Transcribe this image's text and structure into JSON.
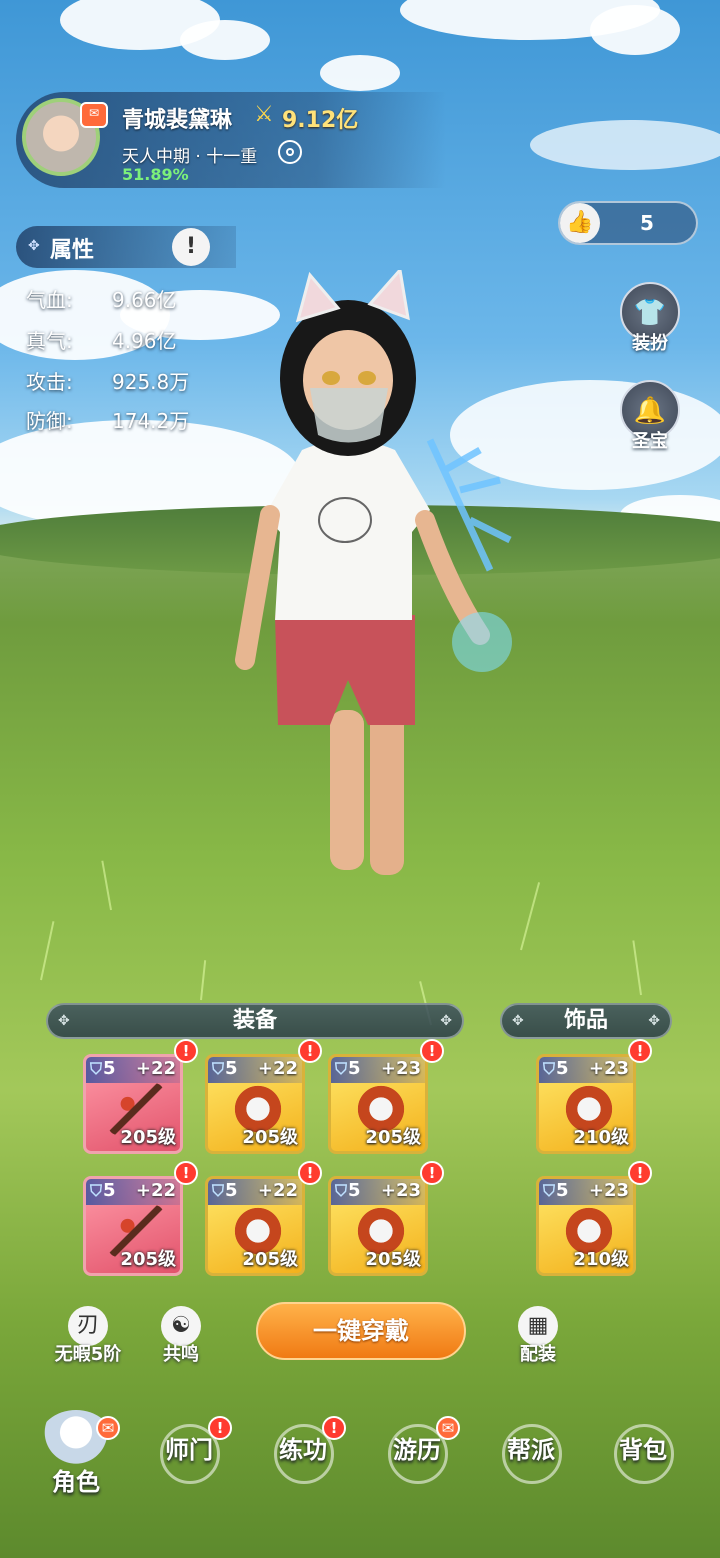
{
  "player": {
    "name": "青城裴黛琳",
    "power": "9.12亿",
    "realm": "天人中期 · 十一重",
    "progress": "51.89%"
  },
  "likes": {
    "count": "5"
  },
  "attributes": {
    "title": "属性",
    "stats": [
      {
        "label": "气血:",
        "value": "9.66亿"
      },
      {
        "label": "真气:",
        "value": "4.96亿"
      },
      {
        "label": "攻击:",
        "value": "925.8万"
      },
      {
        "label": "防御:",
        "value": "174.2万"
      }
    ]
  },
  "side_buttons": {
    "outfit": "装扮",
    "treasure": "圣宝"
  },
  "equipment": {
    "title": "装备",
    "items": [
      {
        "rank": "5",
        "plus": "+22",
        "level": "205级"
      },
      {
        "rank": "5",
        "plus": "+22",
        "level": "205级"
      },
      {
        "rank": "5",
        "plus": "+23",
        "level": "205级"
      },
      {
        "rank": "5",
        "plus": "+22",
        "level": "205级"
      },
      {
        "rank": "5",
        "plus": "+22",
        "level": "205级"
      },
      {
        "rank": "5",
        "plus": "+23",
        "level": "205级"
      }
    ]
  },
  "accessories": {
    "title": "饰品",
    "items": [
      {
        "rank": "5",
        "plus": "+23",
        "level": "210级"
      },
      {
        "rank": "5",
        "plus": "+23",
        "level": "210级"
      }
    ]
  },
  "actions": {
    "flawless": "无暇5阶",
    "resonance": "共鸣",
    "equip_all": "一键穿戴",
    "loadout": "配装"
  },
  "nav": {
    "character": "角色",
    "master": "师门",
    "training": "练功",
    "travel": "游历",
    "guild": "帮派",
    "bag": "背包"
  },
  "colors": {
    "progress_text": "#7cf07a",
    "power_text": "#ffe27a",
    "equip_button": "#f07a14",
    "alert": "#ff3b2f"
  }
}
